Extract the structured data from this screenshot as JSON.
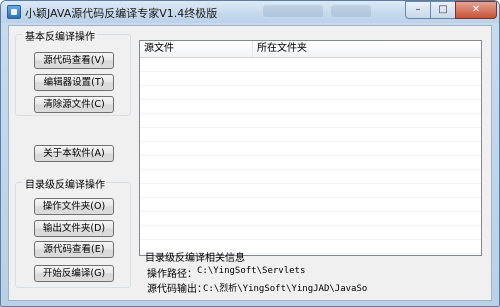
{
  "window": {
    "title": "小颖JAVA源代码反编译专家V1.4终极版",
    "controls": {
      "minimize": "–",
      "maximize": "□",
      "close": "✕"
    }
  },
  "basic_group": {
    "label": "基本反编译操作",
    "buttons": [
      "源代码查看(V)",
      "编辑器设置(T)",
      "清除源文件(C)"
    ]
  },
  "about_button": "关于本软件(A)",
  "dir_group": {
    "label": "目录级反编译操作",
    "buttons": [
      "操作文件夹(O)",
      "输出文件夹(D)",
      "源代码查看(E)",
      "开始反编译(G)"
    ]
  },
  "file_list": {
    "columns": [
      "源文件",
      "所在文件夹"
    ],
    "rows": []
  },
  "info": {
    "title": "目录级反编译相关信息",
    "operation_path_label": "操作路径：",
    "operation_path_value": "C:\\YingSoft\\Servlets",
    "output_label": "源代码输出：",
    "output_value": "C:\\烈析\\YingSoft\\YingJAD\\JavaSo"
  },
  "colors": {
    "titlebar": "#c5d8ec",
    "client": "#f0f0f0",
    "close_button": "#c7513a"
  }
}
